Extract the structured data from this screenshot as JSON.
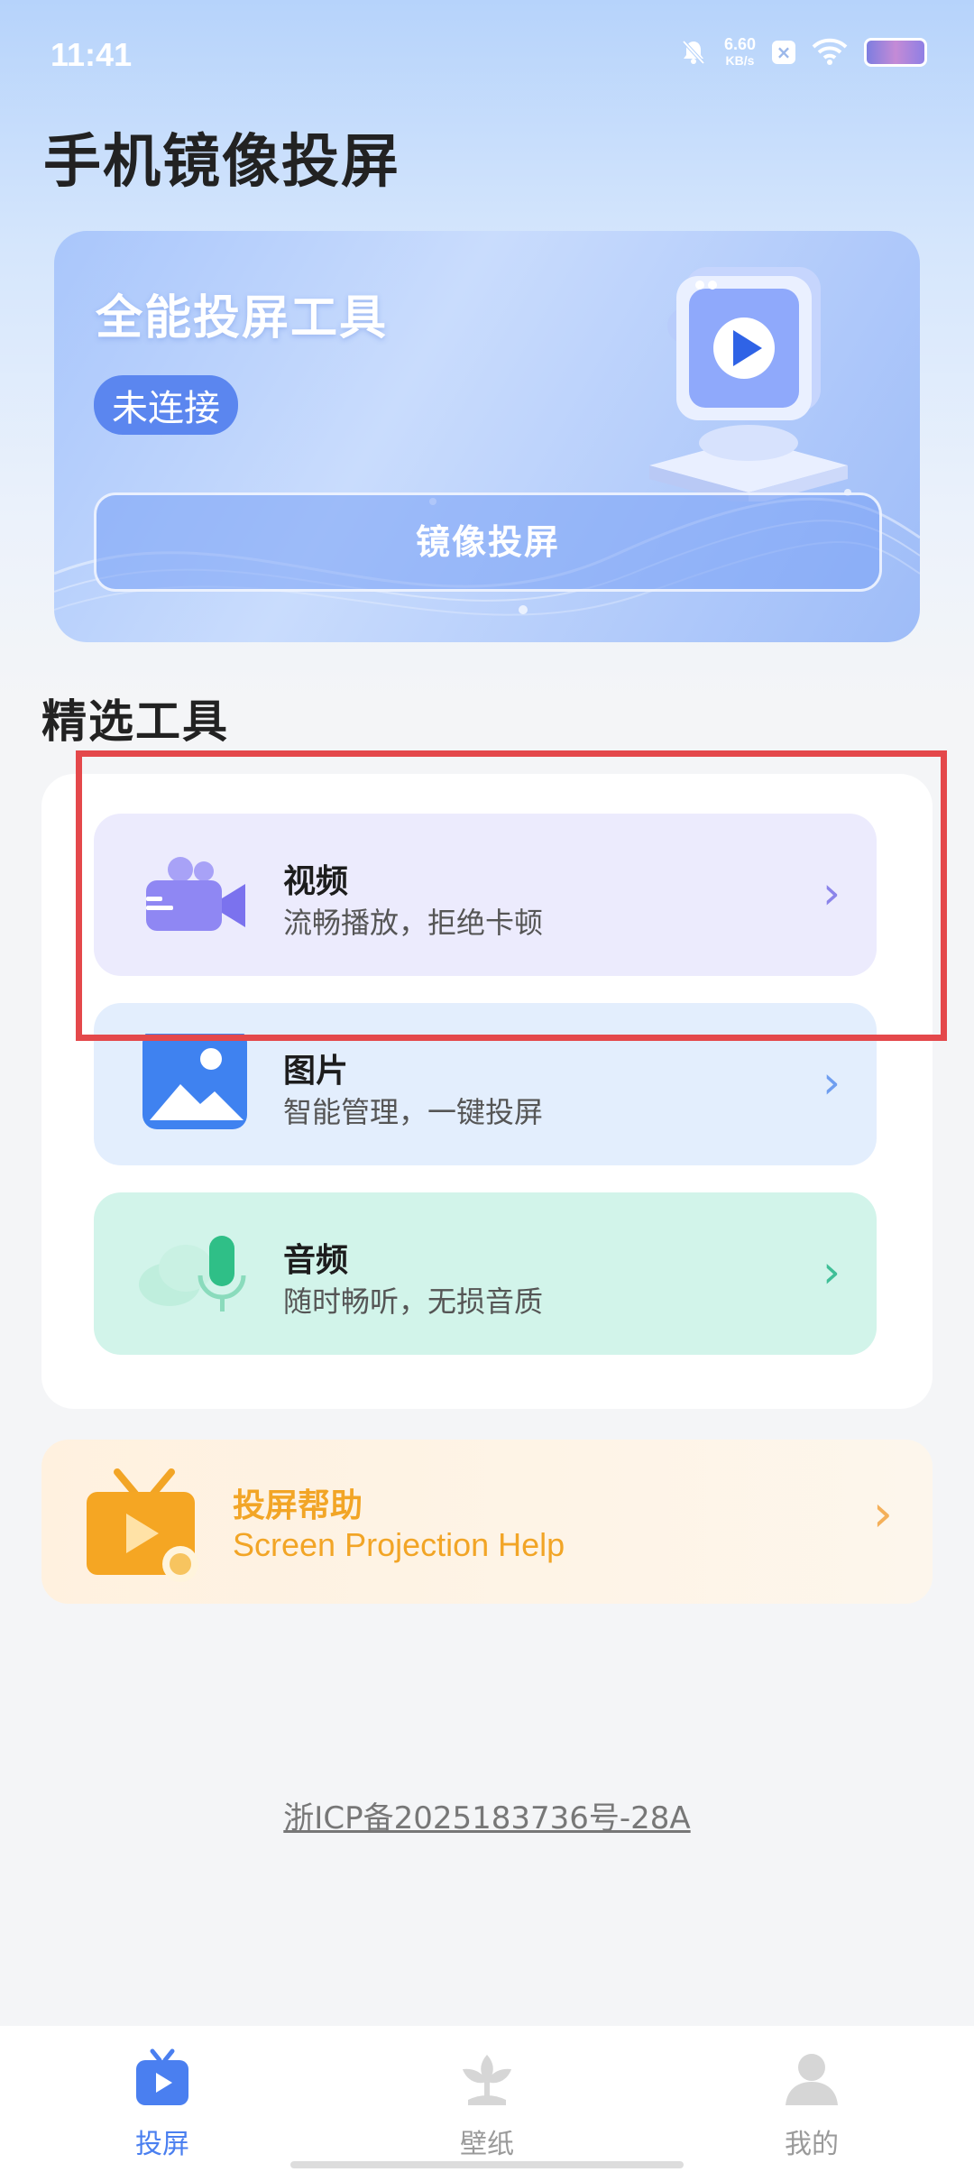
{
  "status_bar": {
    "time": "11:41",
    "net_speed": "6.60",
    "net_unit": "KB/s"
  },
  "page": {
    "title": "手机镜像投屏"
  },
  "banner": {
    "title": "全能投屏工具",
    "status": "未连接",
    "button_label": "镜像投屏"
  },
  "tools": {
    "section_title": "精选工具",
    "items": [
      {
        "name": "视频",
        "desc": "流畅播放，拒绝卡顿",
        "icon": "video-camera-icon",
        "bg": "#ecebfd",
        "chev_color": "#8b84ea"
      },
      {
        "name": "图片",
        "desc": "智能管理，一键投屏",
        "icon": "image-icon",
        "bg": "#e3eefd",
        "chev_color": "#6f9ef0"
      },
      {
        "name": "音频",
        "desc": "随时畅听，无损音质",
        "icon": "microphone-icon",
        "bg": "#d2f4ea",
        "chev_color": "#3fbf97"
      }
    ]
  },
  "help": {
    "title": "投屏帮助",
    "subtitle": "Screen Projection Help"
  },
  "icp": "浙ICP备2025183736号-28A",
  "nav": {
    "items": [
      {
        "label": "投屏",
        "icon": "tv-icon",
        "active": true
      },
      {
        "label": "壁纸",
        "icon": "flower-icon",
        "active": false
      },
      {
        "label": "我的",
        "icon": "person-icon",
        "active": false
      }
    ]
  },
  "colors": {
    "accent": "#4a7ff0",
    "inactive": "#9a9a9a",
    "highlight_border": "#e4484b",
    "help_text": "#f2a526"
  }
}
